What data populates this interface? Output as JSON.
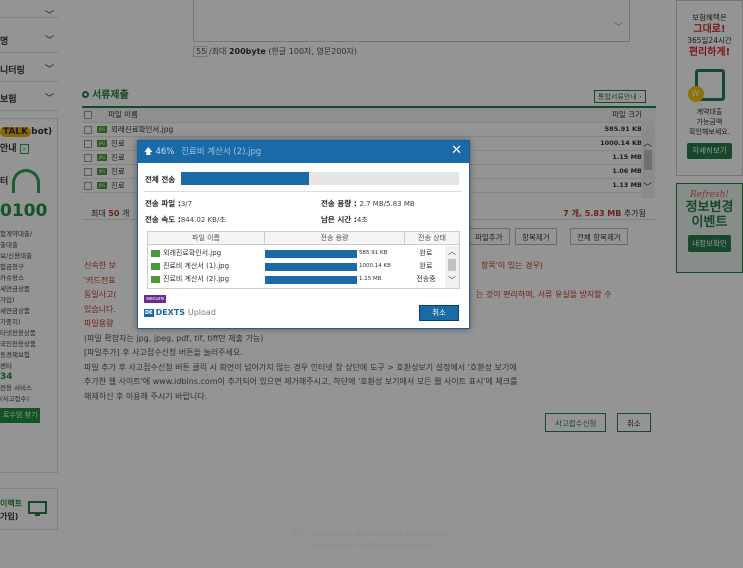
{
  "sidebar": {
    "menus": [
      "명",
      "니터링",
      "보험"
    ],
    "talk": {
      "badge": "TALK",
      "suffix": "bot)",
      "line2": "안내",
      "arrow": "›"
    },
    "phone_label": "터",
    "phone": "0100",
    "links": [
      "험계약대출/",
      "출대출",
      "보/신용대출",
      "험금청구",
      "카슈랑스",
      "세연금상품",
      "가입)",
      "세연금상품",
      "가중지)",
      "터넷전용상품",
      "국인전용상품",
      "동경제보험",
      "센터"
    ],
    "num": "34",
    "links2": [
      "전용 서비스",
      "(사고접수)"
    ],
    "find_btn": "로수임 찾기",
    "bottom": {
      "line1": "이렉트",
      "line2": "가입)"
    }
  },
  "comment": {
    "count": "55",
    "limit_text": "/최대",
    "limit_bold": "200byte",
    "limit_note": "(한글 100자, 영문200자)"
  },
  "section": {
    "title": "서류제출",
    "guide_btn": "통합서류안내 ›"
  },
  "file_table": {
    "col_name": "파일 이름",
    "col_size": "파일 크기",
    "rows": [
      {
        "name": "외래진료확인서.jpg",
        "size": "585.91 KB"
      },
      {
        "name": "진료",
        "size": "1000.14 KB"
      },
      {
        "name": "진료",
        "size": "1.15 MB"
      },
      {
        "name": "진료",
        "size": "1.06 MB"
      },
      {
        "name": "진료",
        "size": "1.13 MB"
      }
    ],
    "summary_left": "최대",
    "summary_max": "50",
    "summary_left_suffix": "개",
    "summary_right": "7 개, 5.83 MB",
    "summary_right_suffix": "추가됨"
  },
  "table_buttons": [
    "파일추가",
    "항목제거",
    "전체 항목제거"
  ],
  "notes": [
    "신속한 보",
    "항목'이 있는 경우)",
    "'카드전표",
    "동일사고(",
    "는 것이 편리하며, 서류 유실을 방지할 수",
    "있습니다.",
    "파일용량",
    "(파일 확장자는 jpg, jpeg, pdf, tif, tiff만 제출 가능)",
    "[파일추가] 후 사고접수신청 버튼을 눌러주세요.",
    "파일 추가 후 사고접수신청 버튼 클릭 시 화면이 넘어가지 않는 경우 인터넷 창 상단에 도구 > 호환성보기 설정에서 '호환성 보기에",
    "추가한 웹 사이트'에 www.idbins.com이 추가되어 있으면 제거해주시고, 하단에 '호환성 보기에서 모든 웹 사이트 표시'에 체크를",
    "해제하신 후 이용해 주시기 바랍니다."
  ],
  "actions": {
    "apply": "사고접수신청",
    "cancel": "취소"
  },
  "footer": {
    "line1": "모리 : Tiny happiness at that moment, but meaningful",
    "line2": "Copyright 2019, 모리's All right Reserved."
  },
  "right_banner": {
    "b1_line1": "보험혜택은",
    "b1_red": "그대로!",
    "b1_line2": "365일24시간",
    "b1_red2": "편리하게!",
    "b1_small": [
      "계약대출",
      "가능금액",
      "확인해보세요."
    ],
    "b1_btn": "자세히보기",
    "b2_refresh": "Refresh!",
    "b2_t1": "정보변경",
    "b2_t2": "이벤트",
    "b2_btn": "내정보확인"
  },
  "dialog": {
    "percent": "46%",
    "current_file": "진료비 계산서 (2).jpg",
    "close": "✕",
    "total_label": "전체 전송",
    "total_progress": 0.46,
    "files_label": "전송 파일 :",
    "files_value": "3/7",
    "size_label": "전송 용량 :",
    "size_value": "2.7 MB/5.83 MB",
    "speed_label": "전송 속도 :",
    "speed_value": "844.02 KB/초",
    "remain_label": "남은 시간 :",
    "remain_value": "4초",
    "cols": [
      "파일 이름",
      "전송 용량",
      "전송 상태"
    ],
    "rows": [
      {
        "name": "외래진료확인서.jpg",
        "size": "585.91 KB",
        "status": "완료",
        "progress": 1
      },
      {
        "name": "진료비 계산서 (1).jpg",
        "size": "1000.14 KB",
        "status": "완료",
        "progress": 1
      },
      {
        "name": "진료비 계산서 (2).jpg",
        "size": "1.15 MB",
        "status": "전송중",
        "progress": 1
      }
    ],
    "secure": "secure",
    "brand_logo": "DE",
    "brand": "DEXTS",
    "brand_suffix": "Upload",
    "cancel": "취소"
  },
  "colors": {
    "accent_green": "#2a7d4a",
    "dialog_blue": "#1b6aa8",
    "alert_red": "#c0392b"
  }
}
